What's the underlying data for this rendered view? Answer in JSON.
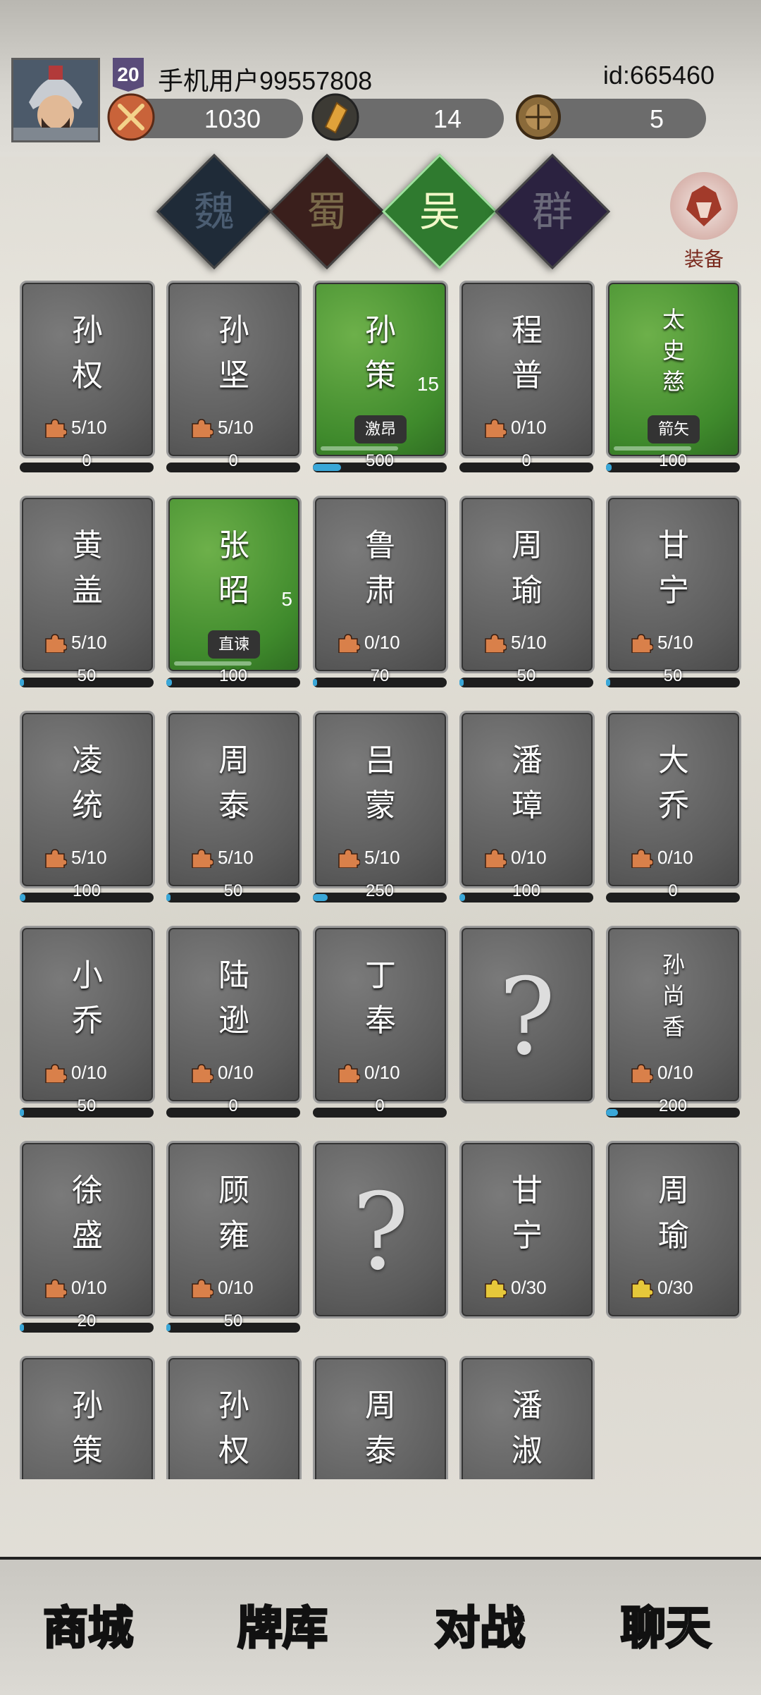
{
  "header": {
    "level": "20",
    "username": "手机用户99557808",
    "userid": "id:665460",
    "stats": [
      {
        "icon": "crossed-swords-icon",
        "value": "1030"
      },
      {
        "icon": "scroll-bag-icon",
        "value": "14"
      },
      {
        "icon": "orb-icon",
        "value": "5"
      }
    ]
  },
  "factions": [
    {
      "label": "魏",
      "color": "#1f2b38",
      "selected": false
    },
    {
      "label": "蜀",
      "color": "#3a1f1c",
      "selected": false
    },
    {
      "label": "吴",
      "color": "#2f7a2f",
      "selected": true
    },
    {
      "label": "群",
      "color": "#2b2240",
      "selected": false
    }
  ],
  "equip_label": "装备",
  "cards": [
    {
      "name": "孙权",
      "frag": "5/10",
      "bar": "0",
      "green": false
    },
    {
      "name": "孙坚",
      "frag": "5/10",
      "bar": "0",
      "green": false
    },
    {
      "name": "孙策",
      "level": "15",
      "skill": "激昂",
      "bar": "500",
      "green": true
    },
    {
      "name": "程普",
      "frag": "0/10",
      "bar": "0",
      "green": false
    },
    {
      "name": "太史慈",
      "skill": "箭矢",
      "bar": "100",
      "green": true
    },
    {
      "name": "黄盖",
      "frag": "5/10",
      "bar": "50",
      "green": false
    },
    {
      "name": "张昭",
      "level": "5",
      "skill": "直谏",
      "bar": "100",
      "green": true
    },
    {
      "name": "鲁肃",
      "frag": "0/10",
      "bar": "70",
      "green": false
    },
    {
      "name": "周瑜",
      "frag": "5/10",
      "bar": "50",
      "green": false
    },
    {
      "name": "甘宁",
      "frag": "5/10",
      "bar": "50",
      "green": false
    },
    {
      "name": "凌统",
      "frag": "5/10",
      "bar": "100",
      "green": false
    },
    {
      "name": "周泰",
      "frag": "5/10",
      "bar": "50",
      "green": false
    },
    {
      "name": "吕蒙",
      "frag": "5/10",
      "bar": "250",
      "green": false
    },
    {
      "name": "潘璋",
      "frag": "0/10",
      "bar": "100",
      "green": false
    },
    {
      "name": "大乔",
      "frag": "0/10",
      "bar": "0",
      "green": false
    },
    {
      "name": "小乔",
      "frag": "0/10",
      "bar": "50",
      "green": false
    },
    {
      "name": "陆逊",
      "frag": "0/10",
      "bar": "0",
      "green": false
    },
    {
      "name": "丁奉",
      "frag": "0/10",
      "bar": "0",
      "green": false
    },
    {
      "name": "?",
      "unknown": true
    },
    {
      "name": "孙尚香",
      "frag": "0/10",
      "bar": "200",
      "green": false
    },
    {
      "name": "徐盛",
      "frag": "0/10",
      "bar": "20",
      "green": false
    },
    {
      "name": "顾雍",
      "frag": "0/10",
      "bar": "50",
      "green": false
    },
    {
      "name": "?",
      "unknown": true
    },
    {
      "name": "甘宁",
      "frag": "0/30",
      "gold": true,
      "green": false
    },
    {
      "name": "周瑜",
      "frag": "0/30",
      "gold": true,
      "green": false
    },
    {
      "name": "孙策",
      "partial": true
    },
    {
      "name": "孙权",
      "partial": true
    },
    {
      "name": "周泰",
      "partial": true
    },
    {
      "name": "潘淑",
      "partial": true
    }
  ],
  "nav": [
    {
      "label": "商城",
      "active": false
    },
    {
      "label": "牌库",
      "active": true
    },
    {
      "label": "对战",
      "active": false
    },
    {
      "label": "聊天",
      "active": false
    }
  ]
}
